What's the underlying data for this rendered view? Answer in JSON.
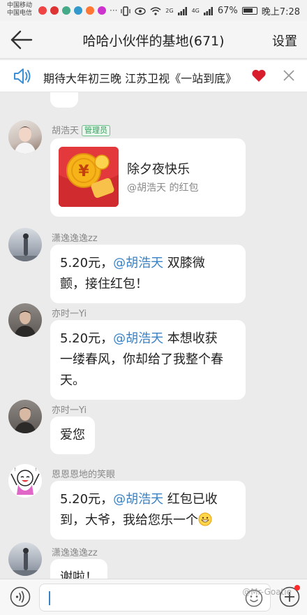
{
  "status_bar": {
    "carrier_1": "中国移动",
    "carrier_2": "中国电信",
    "network_1": "2G",
    "network_2": "4G",
    "battery": "67%",
    "time": "晚上7:28"
  },
  "header": {
    "back_icon": "arrow-left-icon",
    "title": "哈哈小伙伴的基地(671)",
    "settings_label": "设置"
  },
  "banner": {
    "icon": "speaker-icon",
    "text": "期待大年初三晚  江苏卫视《一站到底》",
    "emoji": "heart-icon"
  },
  "messages": [
    {
      "sender": "胡浩天",
      "badge": "管理员",
      "type": "red_packet",
      "packet_title": "除夕夜快乐",
      "packet_sub": "@胡浩天 的红包"
    },
    {
      "sender": "潇逸逸逸zz",
      "type": "text",
      "text_before": "5.20元，",
      "mention": "@胡浩天",
      "text_after": " 双膝微颤，接住红包！",
      "line1_after": " 双膝微",
      "line2": "颤，接住红包！"
    },
    {
      "sender": "亦时一Yi",
      "type": "text",
      "text_before": "5.20元，",
      "mention": "@胡浩天",
      "line1_after": " 本想收获",
      "line2": "一缕春风，你却给了我整个春",
      "line3": "天。"
    },
    {
      "sender": "亦时一Yi",
      "type": "text",
      "text": "爱您"
    },
    {
      "sender": "恩恩恩地的笑眼",
      "type": "text",
      "text_before": "5.20元，",
      "mention": "@胡浩天",
      "line1_after": " 红包已收",
      "line2": "到，大爷，我给您乐一个"
    },
    {
      "sender": "潇逸逸逸zz",
      "type": "text",
      "text": "谢啦！"
    }
  ],
  "input_bar": {
    "voice_icon": "voice-icon",
    "emoji_icon": "smile-icon",
    "plus_icon": "plus-icon"
  },
  "watermark": "@Mr-Goatie",
  "colors": {
    "accent_mention": "#3a82c4",
    "red_packet": "#e4393c",
    "admin_badge": "#33a05a",
    "heart": "#d81e2c"
  }
}
